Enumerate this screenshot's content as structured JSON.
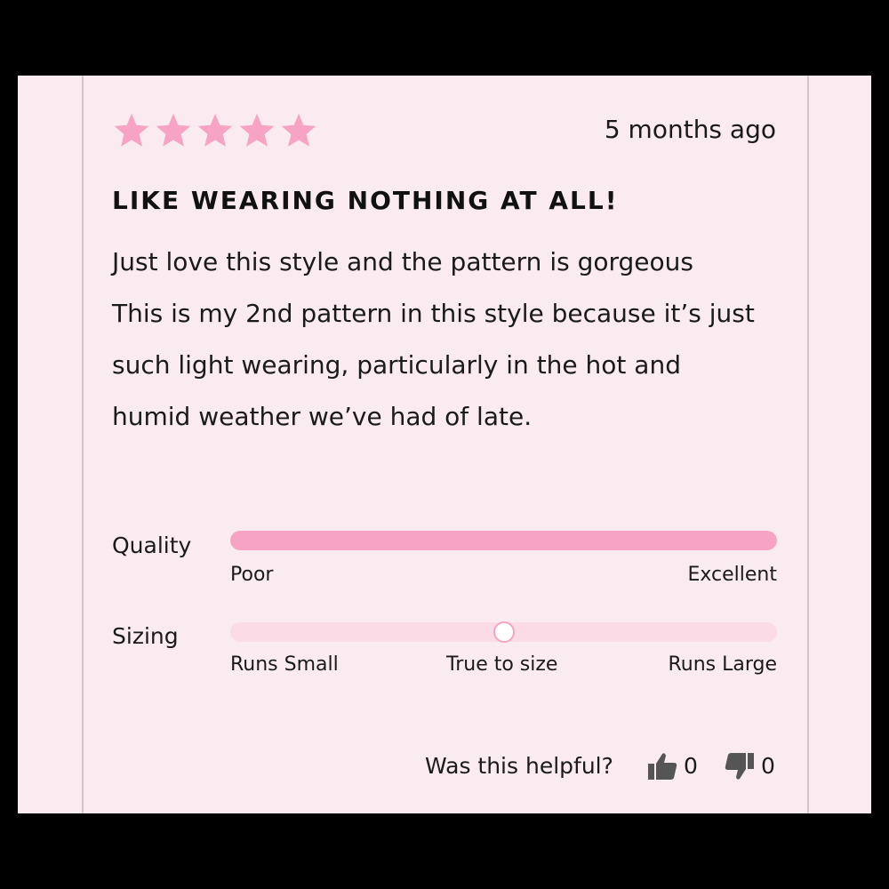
{
  "review": {
    "rating": 5,
    "max_rating": 5,
    "star_color": "#f7a3c3",
    "date": "5 months ago",
    "title": "LIKE WEARING NOTHING AT ALL!",
    "body_lines": [
      "Just love this style and the pattern is gorgeous",
      "This is my 2nd pattern in this style because it’s just",
      "such light wearing, particularly in the hot and",
      "humid weather we’ve had of late."
    ]
  },
  "metrics": {
    "quality": {
      "label": "Quality",
      "value_fraction": 1.0,
      "min_label": "Poor",
      "max_label": "Excellent"
    },
    "sizing": {
      "label": "Sizing",
      "value_fraction": 0.5,
      "min_label": "Runs Small",
      "mid_label": "True to size",
      "max_label": "Runs Large"
    }
  },
  "helpful": {
    "question": "Was this helpful?",
    "up_icon": "thumbs-up-icon",
    "down_icon": "thumbs-down-icon",
    "up_count": "0",
    "down_count": "0"
  },
  "colors": {
    "background": "#f9ebef",
    "accent": "#f7a3c3",
    "track": "#fadbe6",
    "icon": "#555555"
  }
}
